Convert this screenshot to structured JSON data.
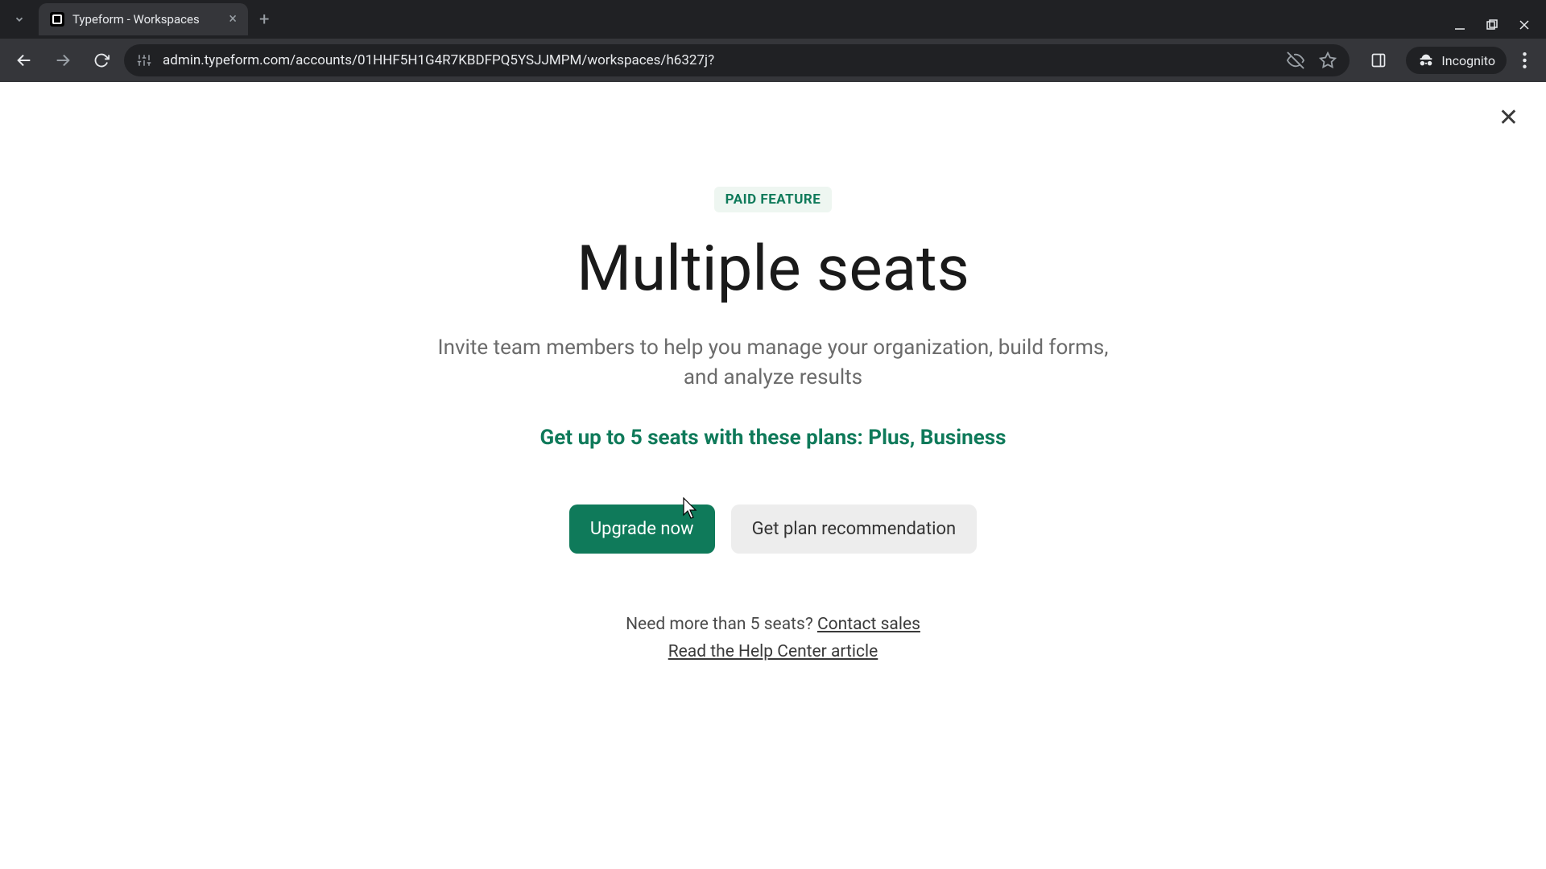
{
  "browser": {
    "tab_title": "Typeform - Workspaces",
    "url": "admin.typeform.com/accounts/01HHF5H1G4R7KBDFPQ5YSJJMPM/workspaces/h6327j?",
    "incognito_label": "Incognito"
  },
  "modal": {
    "badge": "PAID FEATURE",
    "title": "Multiple seats",
    "description": "Invite team members to help you manage your organization, build forms, and analyze results",
    "plans_line": "Get up to 5 seats with these plans: Plus, Business",
    "primary_button": "Upgrade now",
    "secondary_button": "Get plan recommendation",
    "footnote_prefix": "Need more than 5 seats? ",
    "contact_sales": "Contact sales",
    "help_link": "Read the Help Center article"
  }
}
